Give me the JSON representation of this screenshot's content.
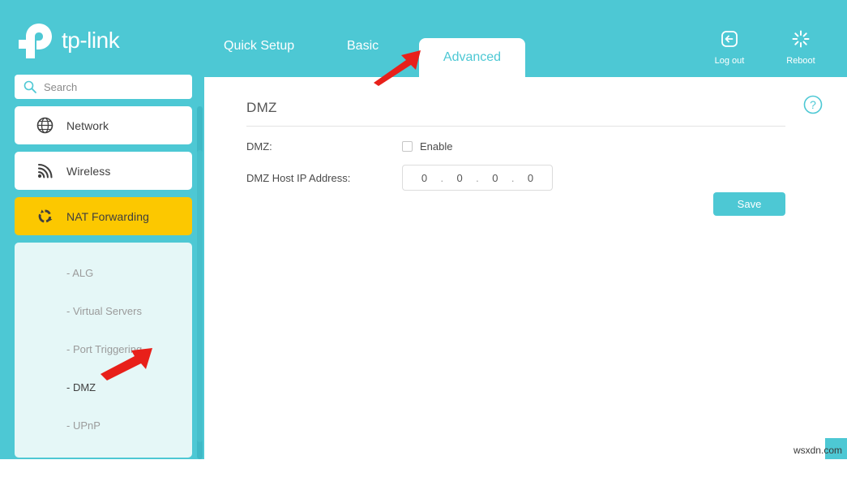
{
  "brand": {
    "name": "tp-link",
    "logo_color": "#ffffff"
  },
  "theme": {
    "primary": "#4dc8d4",
    "accent": "#fcc800",
    "submenu_bg": "#e5f7f7",
    "text": "#4a4a4a",
    "muted": "#9b9b9b",
    "annotation": "#e8201a"
  },
  "search": {
    "placeholder": "Search",
    "value": "",
    "icon": "search-icon"
  },
  "tabs": [
    {
      "label": "Quick Setup",
      "active": false
    },
    {
      "label": "Basic",
      "active": false
    },
    {
      "label": "Advanced",
      "active": true
    }
  ],
  "header_actions": [
    {
      "label": "Log out",
      "icon": "logout-icon"
    },
    {
      "label": "Reboot",
      "icon": "reboot-icon"
    }
  ],
  "sidebar": {
    "items": [
      {
        "label": "Network",
        "icon": "globe-icon",
        "active": false
      },
      {
        "label": "Wireless",
        "icon": "wifi-icon",
        "active": false
      },
      {
        "label": "NAT Forwarding",
        "icon": "nat-forwarding-icon",
        "active": true
      }
    ],
    "submenu": [
      {
        "label": "- ALG",
        "active": false
      },
      {
        "label": "- Virtual Servers",
        "active": false
      },
      {
        "label": "- Port Triggering",
        "active": false
      },
      {
        "label": "- DMZ",
        "active": true
      },
      {
        "label": "- UPnP",
        "active": false
      }
    ]
  },
  "main": {
    "title": "DMZ",
    "help_icon": "help-circle-icon",
    "fields": {
      "dmz": {
        "label": "DMZ:",
        "checkbox_label": "Enable",
        "checked": false
      },
      "host_ip": {
        "label": "DMZ Host IP Address:",
        "octets": [
          "0",
          "0",
          "0",
          "0"
        ],
        "separator": "."
      }
    },
    "save_label": "Save"
  },
  "watermark": {
    "text": "wsxdn.com"
  }
}
